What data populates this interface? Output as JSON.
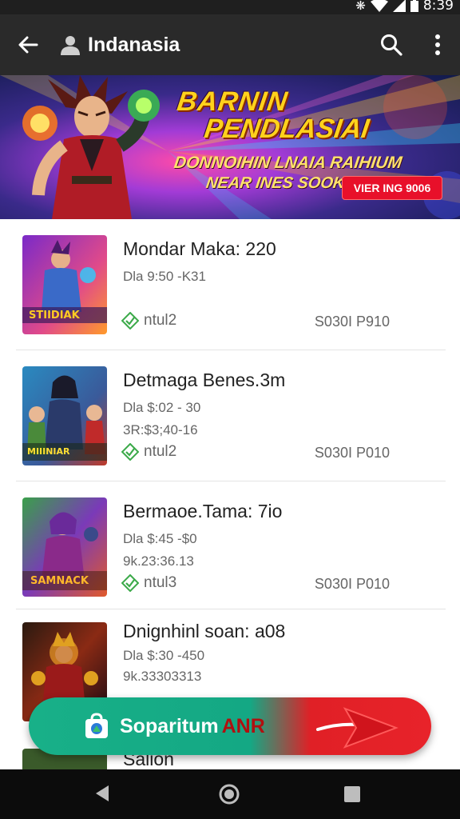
{
  "status": {
    "time": "8:39"
  },
  "app_bar": {
    "title": "Indanasia"
  },
  "banner": {
    "title_line1": "BARNIN",
    "title_line2": "PENDLASIAI",
    "subtitle_line1": "DONNOIHIN LNAIA RAIHIUM",
    "subtitle_line2": "NEAR INES SOOK!",
    "cta_label": "VIER ING 9006"
  },
  "items": [
    {
      "title": "Mondar Maka: 220",
      "line1": "Dla 9:50 -K31",
      "line2": "",
      "badge": "ntul2",
      "price": "S030I P910"
    },
    {
      "title": "Detmaga Benes.3m",
      "line1": "Dla $:02 - 30",
      "line2": "3R:$3;40-16",
      "badge": "ntul2",
      "price": "S030I P010"
    },
    {
      "title": "Bermaoe.Tama: 7io",
      "line1": "Dla $:45 -$0",
      "line2": "9k.23:36.13",
      "badge": "ntul3",
      "price": "S030I P010"
    },
    {
      "title": "Dnignhinl soan: a08",
      "line1": "Dla $:30 -450",
      "line2": "9k.33303313",
      "badge": "",
      "price": ""
    },
    {
      "title": "Salion",
      "line1": "",
      "line2": "",
      "badge": "",
      "price": ""
    }
  ],
  "fab": {
    "label": "Soparitum",
    "label_suffix": "ANR"
  },
  "colors": {
    "app_bar": "#2a2a2a",
    "fab_green": "#18b088",
    "fab_red": "#e8232a",
    "badge_green": "#3caa4a"
  }
}
